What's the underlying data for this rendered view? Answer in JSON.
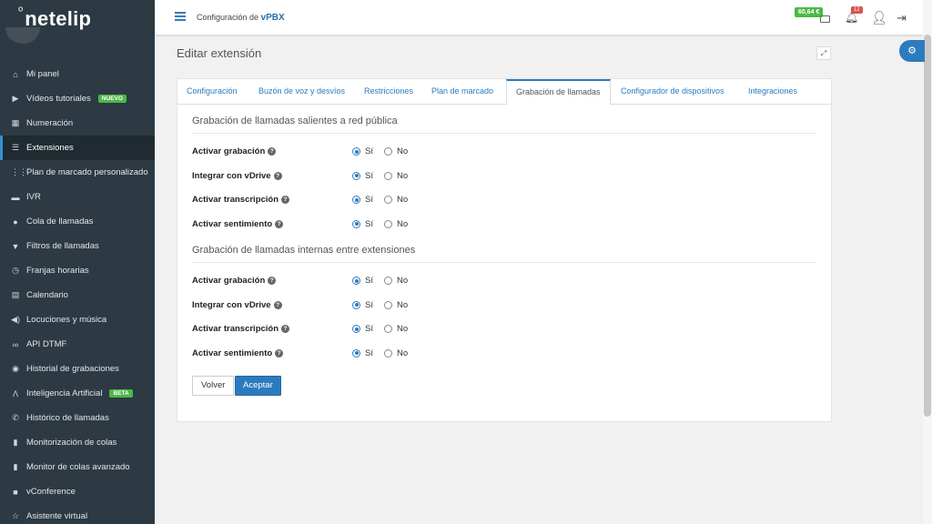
{
  "brand": {
    "name": "netelip"
  },
  "sidebar": {
    "items": [
      {
        "label": "Mi panel",
        "icon": "home-icon",
        "glyph": "⌂"
      },
      {
        "label": "Vídeos tutoriales",
        "icon": "video-icon",
        "glyph": "▶",
        "badge": "NUEVO"
      },
      {
        "label": "Numeración",
        "icon": "grid-icon",
        "glyph": "▦"
      },
      {
        "label": "Extensiones",
        "icon": "list-icon",
        "glyph": "☰",
        "active": true
      },
      {
        "label": "Plan de marcado personalizado",
        "icon": "dialpad-icon",
        "glyph": "⋮⋮"
      },
      {
        "label": "IVR",
        "icon": "chat-icon",
        "glyph": "▬"
      },
      {
        "label": "Cola de llamadas",
        "icon": "user-icon",
        "glyph": "●"
      },
      {
        "label": "Filtros de llamadas",
        "icon": "filter-icon",
        "glyph": "▼"
      },
      {
        "label": "Franjas horarias",
        "icon": "clock-icon",
        "glyph": "◷"
      },
      {
        "label": "Calendario",
        "icon": "calendar-icon",
        "glyph": "▤"
      },
      {
        "label": "Locuciones y música",
        "icon": "speaker-icon",
        "glyph": "◀)"
      },
      {
        "label": "API DTMF",
        "icon": "link-icon",
        "glyph": "∞"
      },
      {
        "label": "Historial de grabaciones",
        "icon": "record-icon",
        "glyph": "◉"
      },
      {
        "label": "Inteligencia Artificial",
        "icon": "ai-icon",
        "glyph": "Λ",
        "badge": "BETA"
      },
      {
        "label": "Histórico de llamadas",
        "icon": "phone-icon",
        "glyph": "✆"
      },
      {
        "label": "Monitorización de colas",
        "icon": "bar-chart-icon",
        "glyph": "▮"
      },
      {
        "label": "Monitor de colas avanzado",
        "icon": "bar-chart-icon",
        "glyph": "▮"
      },
      {
        "label": "vConference",
        "icon": "camera-icon",
        "glyph": "■"
      },
      {
        "label": "Asistente virtual",
        "icon": "star-icon",
        "glyph": "☆"
      }
    ]
  },
  "topbar": {
    "title_prefix": "Configuración de ",
    "title_product": "vPBX",
    "balance": "60,64 €",
    "notifications": "12"
  },
  "page": {
    "title": "Editar extensión"
  },
  "tabs": [
    {
      "label": "Configuración"
    },
    {
      "label": "Buzón de voz y desvíos"
    },
    {
      "label": "Restricciones"
    },
    {
      "label": "Plan de marcado"
    },
    {
      "label": "Grabación de llamadas",
      "active": true
    },
    {
      "label": "Configurador de dispositivos"
    },
    {
      "label": "Integraciones"
    }
  ],
  "sections": [
    {
      "title": "Grabación de llamadas salientes a red pública",
      "rows": [
        {
          "label": "Activar grabación",
          "value": "Sí"
        },
        {
          "label": "Integrar con vDrive",
          "value": "Sí"
        },
        {
          "label": "Activar transcripción",
          "value": "Sí"
        },
        {
          "label": "Activar sentimiento",
          "value": "Sí"
        }
      ]
    },
    {
      "title": "Grabación de llamadas internas entre extensiones",
      "rows": [
        {
          "label": "Activar grabación",
          "value": "Sí"
        },
        {
          "label": "Integrar con vDrive",
          "value": "Sí"
        },
        {
          "label": "Activar transcripción",
          "value": "Sí"
        },
        {
          "label": "Activar sentimiento",
          "value": "Sí"
        }
      ]
    }
  ],
  "options": {
    "yes": "Sí",
    "no": "No"
  },
  "buttons": {
    "back": "Volver",
    "accept": "Aceptar"
  },
  "colors": {
    "sidebar": "#2d3a43",
    "accent": "#2c7bbf",
    "balance": "#4cb848",
    "alert": "#d9534f"
  }
}
